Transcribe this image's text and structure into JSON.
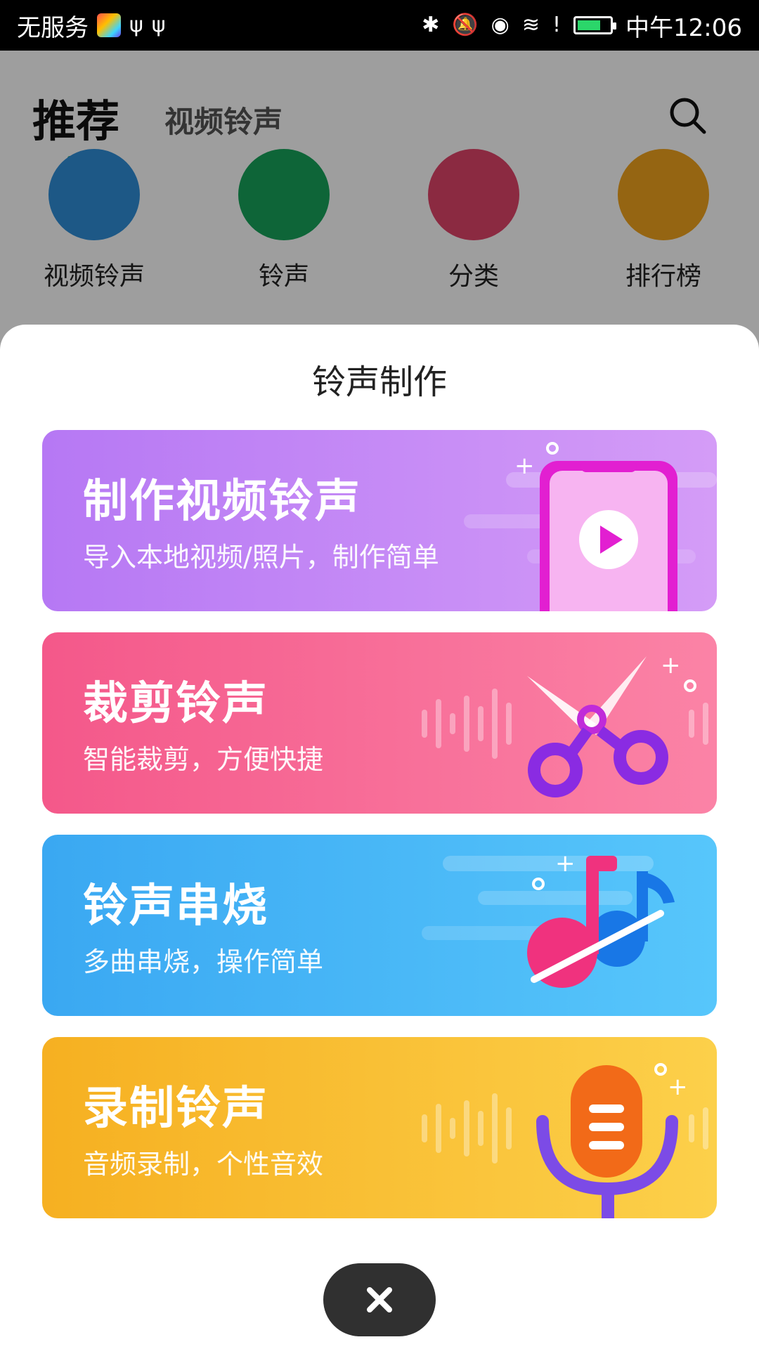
{
  "status_bar": {
    "carrier": "无服务",
    "time": "中午12:06",
    "icons": [
      "app-icon",
      "usb-icon",
      "usb-icon",
      "bluetooth-icon",
      "mute-icon",
      "eye-icon",
      "wifi-icon",
      "alert-icon",
      "battery-charging-icon"
    ]
  },
  "header": {
    "tab_recommend": "推荐",
    "tab_video_ringtone": "视频铃声",
    "search_icon": "search-icon"
  },
  "quick_entries": [
    {
      "label": "视频铃声",
      "color": "#2f8fd8"
    },
    {
      "label": "铃声",
      "color": "#17a35b"
    },
    {
      "label": "分类",
      "color": "#e0446a"
    },
    {
      "label": "排行榜",
      "color": "#f0a31e"
    }
  ],
  "sheet": {
    "title": "铃声制作",
    "cards": [
      {
        "title": "制作视频铃声",
        "subtitle": "导入本地视频/照片，制作简单",
        "icon": "phone-video-icon"
      },
      {
        "title": "裁剪铃声",
        "subtitle": "智能裁剪，方便快捷",
        "icon": "scissors-icon"
      },
      {
        "title": "铃声串烧",
        "subtitle": "多曲串烧，操作简单",
        "icon": "music-note-icon"
      },
      {
        "title": "录制铃声",
        "subtitle": "音频录制，个性音效",
        "icon": "microphone-icon"
      }
    ],
    "close_icon": "close-icon"
  }
}
